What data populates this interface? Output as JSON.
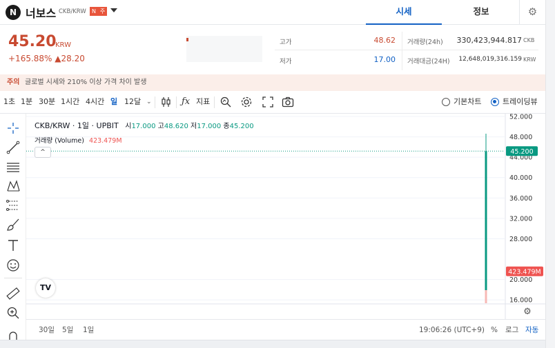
{
  "header": {
    "logo_letter": "N",
    "coin_name": "너보스",
    "pair": "CKB/KRW",
    "badge_n": "N",
    "badge_warning": "주",
    "tabs": [
      {
        "label": "시세",
        "active": true
      },
      {
        "label": "정보",
        "active": false
      }
    ],
    "settings_icon": "gear-icon"
  },
  "price": {
    "current": "45.20",
    "unit": "KRW",
    "change_pct": "+165.88%",
    "change_abs": "▲28.20",
    "high_label": "고가",
    "high_value": "48.62",
    "low_label": "저가",
    "low_value": "17.00",
    "volume_label": "거래량(24h)",
    "volume_value": "330,423,944.817",
    "volume_unit": "CKB",
    "amount_label": "거래대금(24H)",
    "amount_value": "12,648,019,316.159",
    "amount_unit": "KRW"
  },
  "caution": {
    "tag": "주의",
    "message": "글로벌 시세와 210% 이상 가격 차이 발생"
  },
  "toolbar": {
    "intervals": [
      "1초",
      "1분",
      "30분",
      "1시간",
      "4시간",
      "일",
      "12달"
    ],
    "active_interval": "일",
    "indicator_label": "지표",
    "view_basic": "기본차트",
    "view_tradingview": "트레이딩뷰"
  },
  "legend": {
    "symbol": "CKB/KRW · 1일 · UPBIT",
    "open_label": "시",
    "open": "17.000",
    "high_label": "고",
    "high": "48.620",
    "low_label": "저",
    "low": "17.000",
    "close_label": "종",
    "close": "45.200",
    "volume_title": "거래량 (Volume)",
    "volume_value": "423.479M",
    "collapse_glyph": "^"
  },
  "axis": {
    "price_ticks": [
      "52.000",
      "48.000",
      "44.000",
      "40.000",
      "36.000",
      "32.000",
      "28.000",
      "20.000",
      "16.000"
    ],
    "price_tag": "45.200",
    "volume_tag": "423.479M",
    "tag_color_price": "#089981",
    "tag_color_volume": "#ef5350"
  },
  "chart_data": {
    "type": "candlestick",
    "y_min": 14,
    "y_max": 52,
    "candle": {
      "open": 17.0,
      "high": 48.62,
      "low": 17.0,
      "close": 45.2
    },
    "volume": "423.479M"
  },
  "bottom": {
    "ranges": [
      "30일",
      "5일",
      "1일"
    ],
    "time": "19:06:26 (UTC+9)",
    "percent": "%",
    "log": "로그",
    "auto": "자동"
  },
  "colors": {
    "up_red": "#c84a31",
    "accent_blue": "#1261c4",
    "candle_green": "#089981",
    "volume_red": "#ef5350"
  }
}
